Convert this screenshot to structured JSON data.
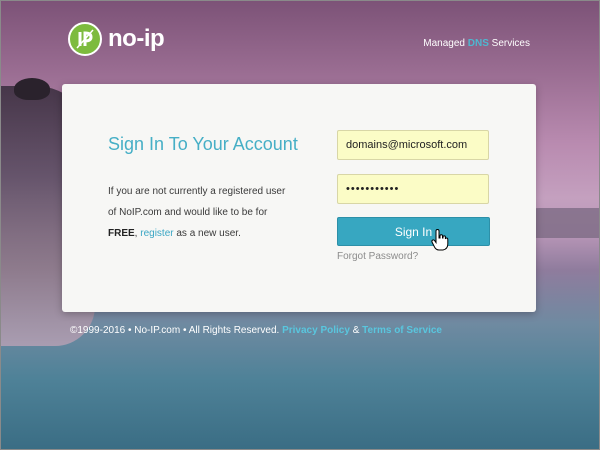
{
  "header": {
    "logo_text": "no-ip",
    "logo_mark": "IP",
    "tagline_prefix": "Managed ",
    "tagline_highlight": "DNS",
    "tagline_suffix": " Services"
  },
  "card": {
    "title": "Sign In To Your Account",
    "description_line1": "If you are not currently a registered user",
    "description_line2": "of NoIP.com and would like to be for",
    "description_free": "FREE",
    "description_comma": ", ",
    "register_link": "register",
    "description_end": " as a new user."
  },
  "form": {
    "email_value": "domains@microsoft.com",
    "password_value": "•••••••••••",
    "signin_label": "Sign In",
    "forgot_label": "Forgot Password?"
  },
  "footer": {
    "copyright": "©1999-2016 • No-IP.com • All Rights Reserved.",
    "privacy_link": "Privacy Policy",
    "amp": "&",
    "terms_link": "Terms of Service"
  },
  "colors": {
    "accent": "#46afc6",
    "button": "#37a7c1",
    "field_bg": "#fbfcc6",
    "logo_green": "#7dbb3e"
  },
  "icons": {
    "logo": "noip-logo-icon",
    "cursor": "hand-pointer-icon"
  }
}
